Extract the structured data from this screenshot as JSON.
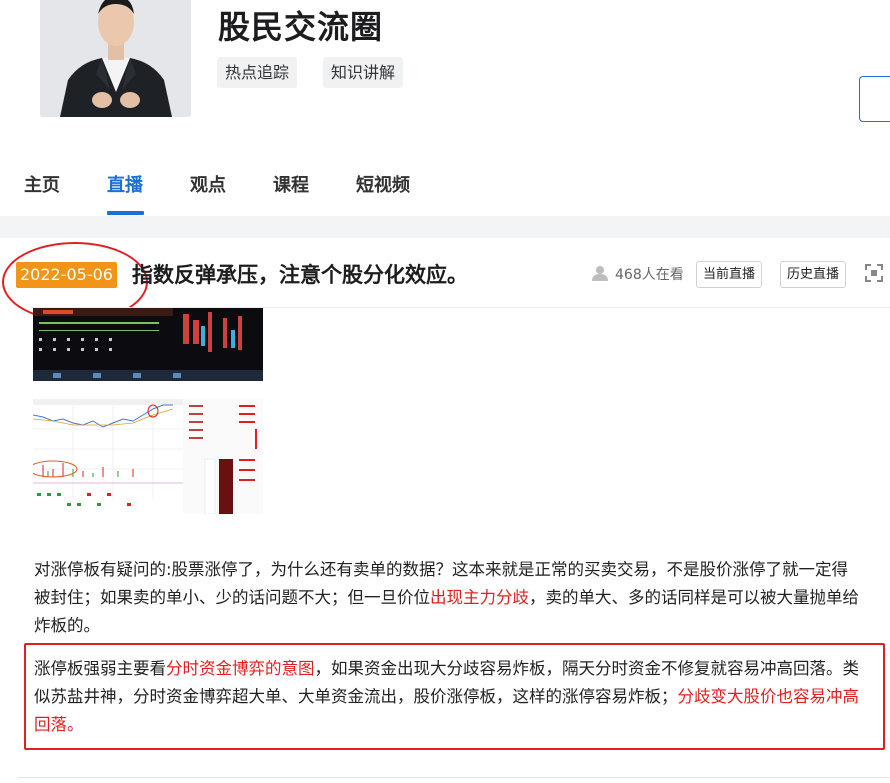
{
  "group": {
    "title": "股民交流圈",
    "tags": [
      "热点追踪",
      "知识讲解"
    ]
  },
  "nav": {
    "tabs": [
      {
        "label": "主页",
        "active": false
      },
      {
        "label": "直播",
        "active": true
      },
      {
        "label": "观点",
        "active": false
      },
      {
        "label": "课程",
        "active": false
      },
      {
        "label": "短视频",
        "active": false
      }
    ]
  },
  "live": {
    "date": "2022-05-06",
    "title": "指数反弹承压，注意个股分化效应。",
    "viewers": "468人在看",
    "current_btn": "当前直播",
    "history_btn": "历史直播"
  },
  "post": {
    "p1_a": "对涨停板有疑问的:股票涨停了，为什么还有卖单的数据？这本来就是正常的买卖交易，不是股价涨停了就一定得被封住；如果卖的单小、少的话问题不大；但一旦价位",
    "p1_red": "出现主力分歧",
    "p1_b": "，卖的单大、多的话同样是可以被大量抛单给炸板的。",
    "p2_a": "涨停板强弱主要看",
    "p2_red1": "分时资金博弈的意图",
    "p2_b": "，如果资金出现大分歧容易炸板，隔天分时资金不修复就容易冲高回落。类似苏盐井神，分时资金博弈超大单、大单资金流出，股价涨停板，这样的涨停容易炸板；",
    "p2_red2": "分歧变大股价也容易冲高回落。"
  },
  "colors": {
    "accent": "#1a6fd8",
    "badge": "#f29418",
    "highlight": "#e02020"
  }
}
